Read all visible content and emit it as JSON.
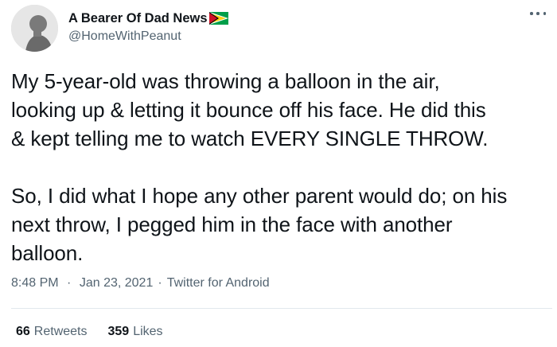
{
  "user": {
    "display_name": "A Bearer Of Dad News",
    "handle": "@HomeWithPeanut",
    "flag_icon": "guyana-flag-icon",
    "avatar_icon": "avatar-photo"
  },
  "more_icon": "more-options-icon",
  "tweet": {
    "text": "My 5-year-old was throwing a balloon in the air,\nlooking up & letting it bounce off his face. He did this\n& kept telling me to watch EVERY SINGLE THROW.\n\nSo, I did what I hope any other parent would do; on his\nnext throw, I pegged him in the face with another\nballoon."
  },
  "meta": {
    "time": "8:48 PM",
    "separator": "·",
    "date": "Jan 23, 2021",
    "source": "Twitter for Android"
  },
  "stats": {
    "retweets_count": "66",
    "retweets_label": "Retweets",
    "likes_count": "359",
    "likes_label": "Likes"
  },
  "colors": {
    "text": "#0f1419",
    "secondary": "#536471",
    "divider": "#e1e8ed"
  }
}
